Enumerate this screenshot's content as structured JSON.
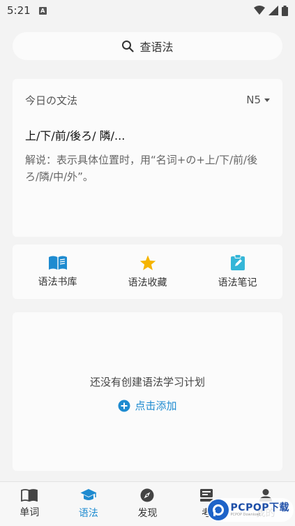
{
  "status_bar": {
    "time": "5:21",
    "badge": "A"
  },
  "search": {
    "placeholder": "查语法"
  },
  "daily_grammar": {
    "header": "今日の文法",
    "level": "N5",
    "title": "上/下/前/後ろ/ 隣/...",
    "explanation": "解说：表示具体位置时，用“名词+の+上/下/前/後ろ/隣/中/外”。"
  },
  "quick_actions": [
    {
      "label": "语法书库",
      "icon": "book-open-icon"
    },
    {
      "label": "语法收藏",
      "icon": "star-icon"
    },
    {
      "label": "语法笔记",
      "icon": "clipboard-edit-icon"
    }
  ],
  "study_plan": {
    "empty_text": "还没有创建语法学习计划",
    "add_label": "点击添加"
  },
  "tabs": [
    {
      "label": "单词",
      "icon": "book-icon"
    },
    {
      "label": "语法",
      "icon": "graduation-cap-icon"
    },
    {
      "label": "发现",
      "icon": "compass-icon"
    },
    {
      "label": "考",
      "icon": "exam-icon"
    },
    {
      "label": "我的",
      "icon": "person-icon"
    }
  ],
  "watermark": {
    "brand": "PCPOP下载",
    "sub": "PCPOP Download"
  },
  "colors": {
    "accent": "#1e8bd0",
    "star": "#f5b400",
    "background": "#f3f3f3",
    "card": "#fbfbfb"
  }
}
